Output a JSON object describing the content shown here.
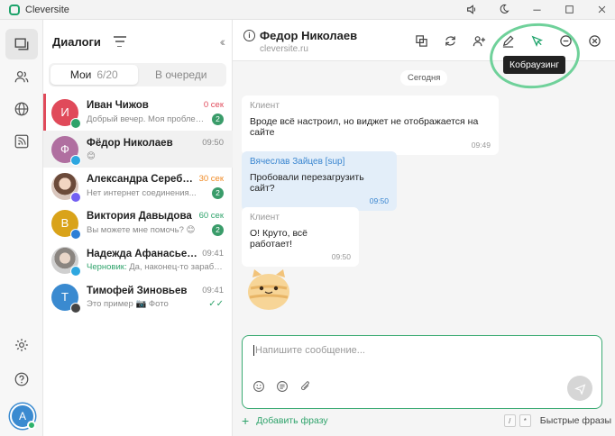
{
  "app": {
    "title": "Cleversite"
  },
  "titlebar_icons": [
    "volume-icon",
    "moon-icon",
    "minimize-icon",
    "maximize-icon",
    "close-icon"
  ],
  "sidebar": {
    "header_title": "Диалоги",
    "tabs": [
      {
        "label": "Мои",
        "count": "6/20"
      },
      {
        "label": "В очереди",
        "count": ""
      }
    ],
    "me_avatar": "А",
    "dialogs": [
      {
        "initial": "И",
        "color": "#e04a5a",
        "channel_color": "#2fa36b",
        "name": "Иван Чижов",
        "time": "0 сек",
        "time_color": "#e04a5a",
        "preview": "Добрый вечер. Моя проблема...",
        "badge": "2",
        "draft_label": "",
        "checks": ""
      },
      {
        "initial": "Ф",
        "color": "#b06fa0",
        "channel_color": "#2ea7e0",
        "name": "Фёдор Николаев",
        "time": "09:50",
        "time_color": "#888888",
        "preview": "😊",
        "badge": "",
        "draft_label": "",
        "checks": ""
      },
      {
        "initial": "",
        "color": "#c9a58f",
        "channel_color": "#7360f2",
        "name": "Александра Серебряк...",
        "time": "30 сек",
        "time_color": "#f08a24",
        "preview": "Нет интернет соединения...",
        "badge": "2",
        "draft_label": "",
        "checks": ""
      },
      {
        "initial": "В",
        "color": "#d9a31a",
        "channel_color": "#2d7fd6",
        "name": "Виктория Давыдова",
        "time": "60 сек",
        "time_color": "#2fa36b",
        "preview": "Вы можете мне помочь? 😊",
        "badge": "2",
        "draft_label": "",
        "checks": ""
      },
      {
        "initial": "",
        "color": "#b8b5b0",
        "channel_color": "#2ea7e0",
        "name": "Надежда Афанасьева",
        "time": "09:41",
        "time_color": "#888888",
        "preview": "Да, наконец-то заработало!",
        "badge": "",
        "draft_label": "Черновик:",
        "checks": ""
      },
      {
        "initial": "Т",
        "color": "#3a8ad0",
        "channel_color": "#444444",
        "name": "Тимофей Зиновьев",
        "time": "09:41",
        "time_color": "#888888",
        "preview": "Это пример 📷 Фото",
        "badge": "",
        "draft_label": "",
        "checks": "✓✓"
      }
    ]
  },
  "chat": {
    "name": "Федор Николаев",
    "site": "cleversite.ru",
    "tooltip": "Кобраузинг",
    "day_label": "Сегодня",
    "messages": [
      {
        "author": "Клиент",
        "text": "Вроде всё настроил, но виджет не отображается на сайте",
        "time": "09:49"
      },
      {
        "author": "Вячеслав Зайцев [sup]",
        "text": "Пробовали перезагрузить сайт?",
        "time": "09:50"
      },
      {
        "author": "Клиент",
        "text": "О! Круто, всё работает!",
        "time": "09:50"
      }
    ],
    "compose_placeholder": "Напишите сообщение...",
    "add_phrase": "Добавить фразу",
    "key_slash": "/",
    "key_star": "*",
    "quick_phrases": "Быстрые фразы"
  }
}
